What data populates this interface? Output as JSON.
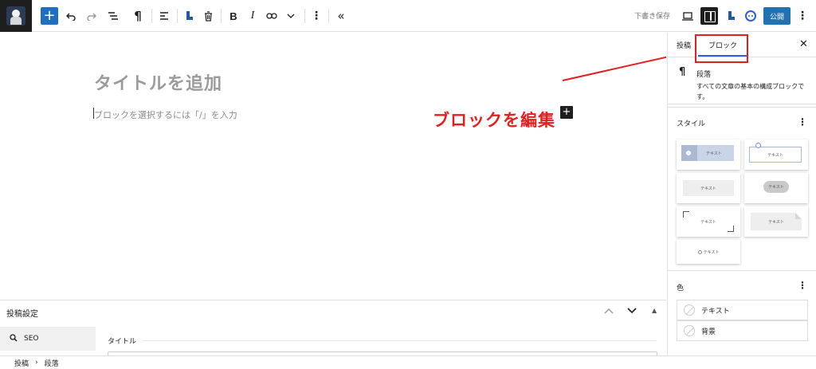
{
  "toolbar": {
    "save_draft": "下書き保存",
    "publish": "公開",
    "bold": "B",
    "italic": "I",
    "paragraph_symbol": "¶"
  },
  "editor": {
    "title_placeholder": "タイトルを追加",
    "block_placeholder": "ブロックを選択するには「/」を入力",
    "annotation": "ブロックを編集"
  },
  "sidebar": {
    "tabs": [
      "投稿",
      "ブロック"
    ],
    "block_name": "段落",
    "block_description": "すべての文章の基本の構成ブロックです。",
    "styles_title": "スタイル",
    "style_sample_text": "テキスト",
    "color_title": "色",
    "color_items": [
      "テキスト",
      "背景"
    ]
  },
  "settings_panel": {
    "title": "投稿設定",
    "seo_tab": "SEO",
    "title_label": "タイトル"
  },
  "breadcrumb": [
    "投稿",
    "段落"
  ],
  "colors": {
    "accent": "#2271b1",
    "annotation": "#e3201f",
    "tab_indicator": "#3858e9"
  }
}
